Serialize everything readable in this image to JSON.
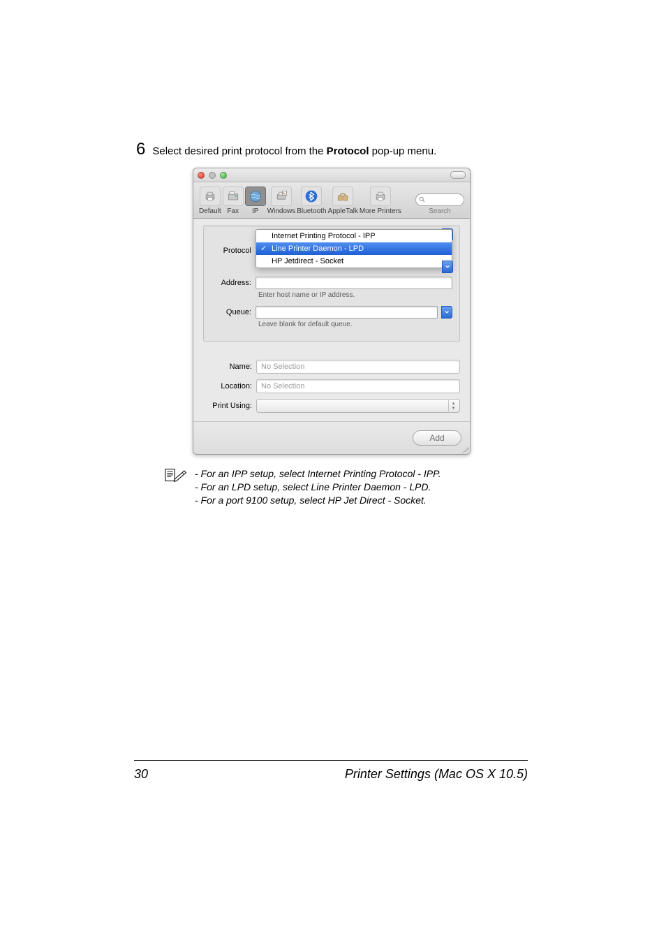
{
  "step": {
    "number": "6",
    "text_before": "Select desired print protocol from the ",
    "bold": "Protocol",
    "text_after": " pop-up menu."
  },
  "toolbar": {
    "items": [
      {
        "label": "Default",
        "icon": "printer"
      },
      {
        "label": "Fax",
        "icon": "fax"
      },
      {
        "label": "IP",
        "icon": "globe",
        "selected": true
      },
      {
        "label": "Windows",
        "icon": "windows"
      },
      {
        "label": "Bluetooth",
        "icon": "bluetooth"
      },
      {
        "label": "AppleTalk",
        "icon": "appletalk"
      },
      {
        "label": "More Printers",
        "icon": "more"
      }
    ],
    "search_label": "Search"
  },
  "form": {
    "protocol_label": "Protocol",
    "protocol_options": [
      "Internet Printing Protocol - IPP",
      "Line Printer Daemon - LPD",
      "HP Jetdirect - Socket"
    ],
    "protocol_selected_index": 1,
    "address_label": "Address:",
    "address_hint": "Enter host name or IP address.",
    "queue_label": "Queue:",
    "queue_hint": "Leave blank for default queue.",
    "name_label": "Name:",
    "name_value": "No Selection",
    "location_label": "Location:",
    "location_value": "No Selection",
    "printusing_label": "Print Using:",
    "add_button": "Add"
  },
  "note": {
    "line1": "- For an IPP setup, select Internet Printing Protocol - IPP.",
    "line2": "- For an LPD setup, select Line Printer Daemon - LPD.",
    "line3": "- For a port 9100 setup, select HP Jet Direct - Socket."
  },
  "footer": {
    "page": "30",
    "title": "Printer Settings (Mac OS X 10.5)"
  }
}
